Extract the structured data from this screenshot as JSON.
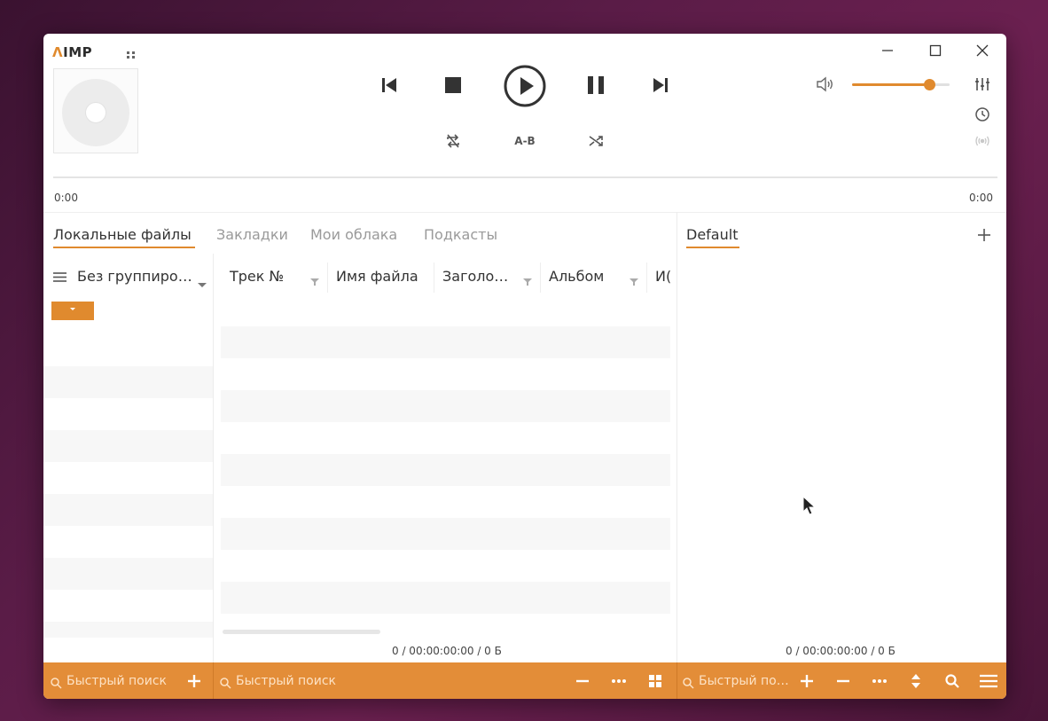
{
  "app": {
    "logo_mark": "Λ",
    "logo_text": "IMP"
  },
  "player": {
    "ab_label": "A-B",
    "time_elapsed": "0:00",
    "time_total": "0:00",
    "volume_level": 0.8
  },
  "library": {
    "tabs": [
      {
        "label": "Локальные файлы",
        "active": true
      },
      {
        "label": "Закладки",
        "active": false
      },
      {
        "label": "Мои облака",
        "active": false
      },
      {
        "label": "Подкасты",
        "active": false
      }
    ],
    "grouping_label": "Без группиро…",
    "columns": [
      "Трек №",
      "Имя файла",
      "Заголо…",
      "Альбом",
      "И("
    ],
    "status": "0 / 00:00:00:00 / 0 Б"
  },
  "playlist": {
    "tab_label": "Default",
    "status": "0 / 00:00:00:00 / 0 Б"
  },
  "bottom": {
    "search1_placeholder": "Быстрый поиск",
    "search2_placeholder": "Быстрый поиск",
    "search3_placeholder": "Быстрый по…"
  },
  "colors": {
    "accent": "#e08a2e",
    "bar": "#e38d38"
  }
}
